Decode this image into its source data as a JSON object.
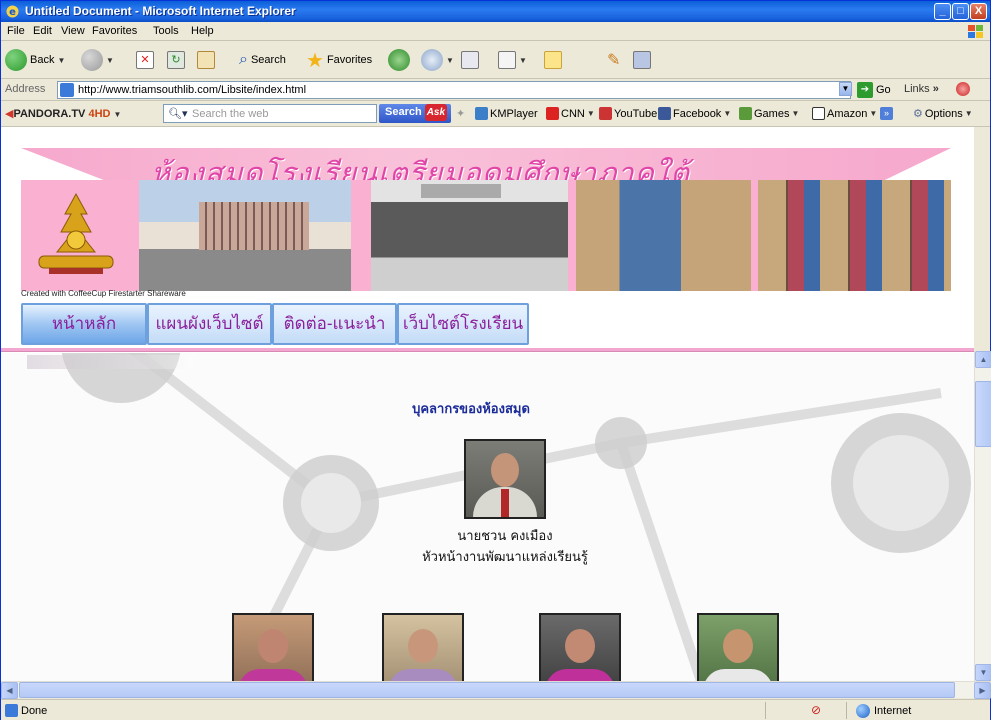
{
  "window": {
    "title": "Untitled Document - Microsoft Internet Explorer",
    "min_label": "_",
    "max_label": "□",
    "close_label": "X"
  },
  "menu": [
    "File",
    "Edit",
    "View",
    "Favorites",
    "Tools",
    "Help"
  ],
  "toolbar": {
    "back_label": "Back",
    "search_label": "Search",
    "favorites_label": "Favorites"
  },
  "address": {
    "label": "Address",
    "url": "http://www.triamsouthlib.com/Libsite/index.html",
    "go_label": "Go",
    "links_label": "Links"
  },
  "pandora": {
    "brand_prefix": "PANDORA.TV",
    "brand_suffix": "4HD",
    "search_placeholder": "Search the web",
    "search_button": "Search",
    "ask_label": "Ask",
    "items": [
      "KMPlayer",
      "CNN",
      "YouTube",
      "Facebook",
      "Games",
      "Amazon"
    ],
    "options_label": "Options"
  },
  "site": {
    "banner_title": "ห้องสมุดโรงเรียนเตรียมอุดมศึกษาภาคใต้",
    "created_with": "Created with CoffeeCup Firestarter Shareware",
    "nav": [
      "หน้าหลัก",
      "แผนผังเว็บไซต์",
      "ติดต่อ-แนะนำ",
      "เว็บไซต์โรงเรียน"
    ]
  },
  "content": {
    "heading": "บุคลากรของห้องสมุด",
    "chief_name": "นายชวน คงเมือง",
    "chief_role": "หัวหน้างานพัฒนาแหล่งเรียนรู้"
  },
  "status": {
    "text": "Done",
    "zone": "Internet"
  },
  "colors": {
    "title_bar": "#0a5fd8",
    "banner_pink": "#f6a8cc",
    "banner_text": "#e046a8",
    "nav_text": "#8b1e9b",
    "heading_text": "#1b2b99"
  }
}
